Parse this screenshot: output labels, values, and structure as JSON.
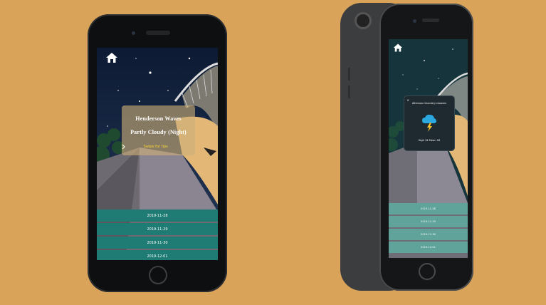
{
  "phone1": {
    "card": {
      "location": "Henderson Waves",
      "condition": "Partly Cloudy (Night)",
      "swipe_hint": "Swipe for tips"
    },
    "dates": [
      "2019-11-28",
      "2019-11-29",
      "2019-11-30",
      "2019-12-01"
    ]
  },
  "phone2": {
    "popup": {
      "close": "x",
      "forecast": "Afternoon thundery showers",
      "footer": "High 34 Mean 26"
    },
    "dates": [
      "2019-11-28",
      "2019-11-29",
      "2019-11-30",
      "2019-12-01"
    ]
  },
  "colors": {
    "background": "#D9A45A",
    "date_row_dark": "#1E7C74",
    "date_row_light": "#5FA39B",
    "swipe_text": "#F7D736"
  },
  "icons": [
    "home-icon",
    "chevron-right-icon",
    "close-icon",
    "thunder-cloud-icon"
  ]
}
